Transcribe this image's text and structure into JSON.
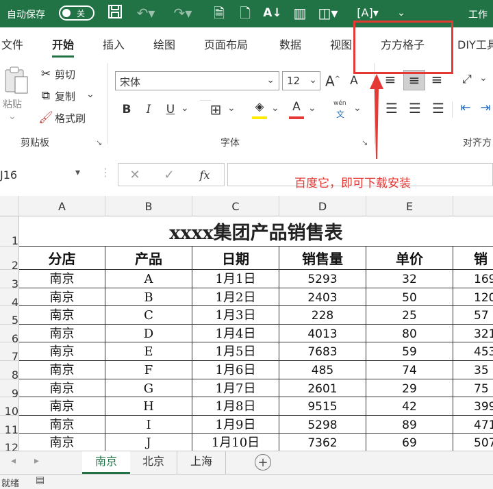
{
  "titlebar": {
    "autosave_label": "自动保存",
    "toggle_state": "关",
    "doc_title": "工作"
  },
  "tabs": [
    "文件",
    "开始",
    "插入",
    "绘图",
    "页面布局",
    "数据",
    "视图",
    "方方格子",
    "DIY工具"
  ],
  "ribbon": {
    "paste_label": "粘贴",
    "cut_label": "剪切",
    "copy_label": "复制",
    "format_painter_label": "格式刷",
    "group_clipboard": "剪贴板",
    "font_name": "宋体",
    "font_size": "12",
    "group_font": "字体",
    "group_align": "对齐方",
    "bold": "B",
    "italic": "I",
    "underline": "U",
    "phonetic_top": "wén",
    "phonetic_bottom": "文"
  },
  "formula_bar": {
    "cell_ref": "J16",
    "fx": "fx"
  },
  "annotation": {
    "note": "百度它，即可下载安装"
  },
  "sheet": {
    "columns": [
      "A",
      "B",
      "C",
      "D",
      "E"
    ],
    "row_numbers": [
      "1",
      "2",
      "3",
      "4",
      "5",
      "6",
      "7",
      "8",
      "9",
      "10",
      "11",
      "12"
    ],
    "title": "xxxx集团产品销售表",
    "headers": [
      "分店",
      "产品",
      "日期",
      "销售量",
      "单价",
      "销"
    ],
    "rows": [
      [
        "南京",
        "A",
        "1月1日",
        "5293",
        "32",
        "169"
      ],
      [
        "南京",
        "B",
        "1月2日",
        "2403",
        "50",
        "120"
      ],
      [
        "南京",
        "C",
        "1月3日",
        "228",
        "25",
        "57"
      ],
      [
        "南京",
        "D",
        "1月4日",
        "4013",
        "80",
        "321"
      ],
      [
        "南京",
        "E",
        "1月5日",
        "7683",
        "59",
        "453"
      ],
      [
        "南京",
        "F",
        "1月6日",
        "485",
        "74",
        "35"
      ],
      [
        "南京",
        "G",
        "1月7日",
        "2601",
        "29",
        "75"
      ],
      [
        "南京",
        "H",
        "1月8日",
        "9515",
        "42",
        "399"
      ],
      [
        "南京",
        "I",
        "1月9日",
        "5298",
        "89",
        "471"
      ],
      [
        "南京",
        "J",
        "1月10日",
        "7362",
        "69",
        "507"
      ]
    ]
  },
  "sheet_tabs": [
    "南京",
    "北京",
    "上海"
  ],
  "status": {
    "ready": "就绪"
  },
  "colors": {
    "excel_green": "#217346",
    "annotation_red": "#e53935"
  }
}
